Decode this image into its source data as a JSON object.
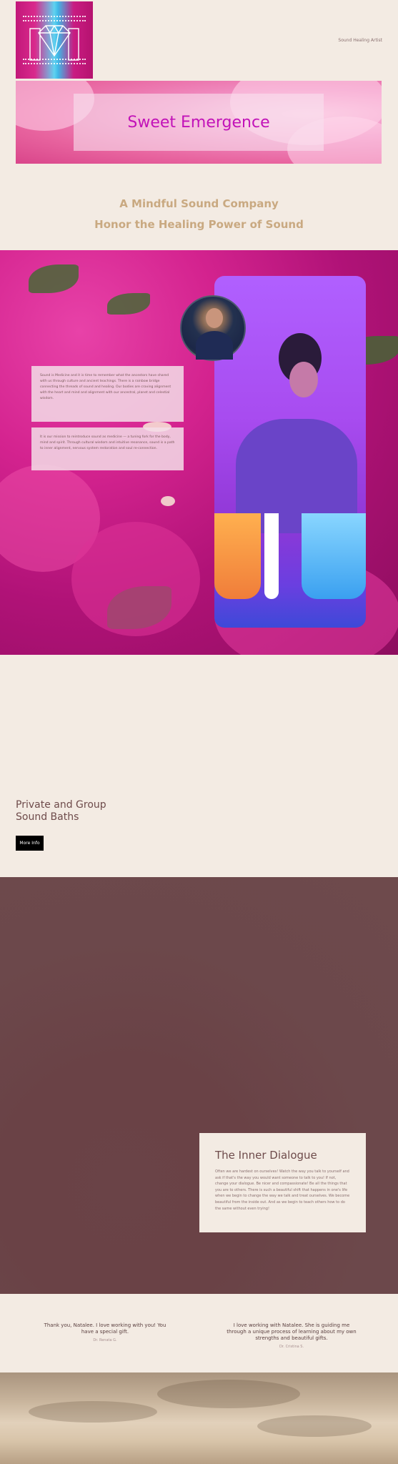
{
  "header": {
    "tagline": "Sound Healing Artist"
  },
  "banner": {
    "title": "Sweet Emergence"
  },
  "headlines": {
    "line1": "A Mindful Sound Company",
    "line2": "Honor the Healing Power of Sound"
  },
  "about": {
    "card1": "Sound is Medicine and it is time to remember what the ancestors have shared with us through culture and ancient teachings. There is a rainbow bridge connecting the threads of sound and healing. Our bodies are craving alignment with the heart and mind and alignment with our ancestral, planet and celestial wisdom.",
    "card2": "It is our mission to reintroduce sound as medicine — a tuning fork for the body, mind and spirit. Through cultural wisdom and intuitive resonance, sound is a path to inner alignment, nervous system restoration and soul re-connection."
  },
  "baths": {
    "title_line1": "Private and Group",
    "title_line2": "Sound Baths",
    "button_label": "More Info"
  },
  "dialogue": {
    "title": "The Inner Dialogue",
    "text": "Often we are hardest on ourselves! Watch the way you talk to yourself and ask if that's the way you would want someone to talk to you! If not, change your dialogue. Be nicer and compassionate! Be all the things that you are to others. There is such a beautiful shift that happens in one's life when we begin to change the way we talk and treat ourselves. We become beautiful from the inside out. And as we begin to teach others how to do the same without even trying!"
  },
  "testimonials": [
    {
      "quote": "Thank you, Natalee. I love working with you! You have a special gift.",
      "author": "Dr. Renata G."
    },
    {
      "quote": "I love working with Natalee. She is guiding me through a unique process of learning about my own strengths and beautiful gifts.",
      "author": "Dr. Cristina S."
    }
  ],
  "colors": {
    "background": "#f3ebe3",
    "headline": "#c9a981",
    "banner_title": "#c212b8",
    "dialogue_bg": "#6e4a4c",
    "button": "#000000"
  }
}
